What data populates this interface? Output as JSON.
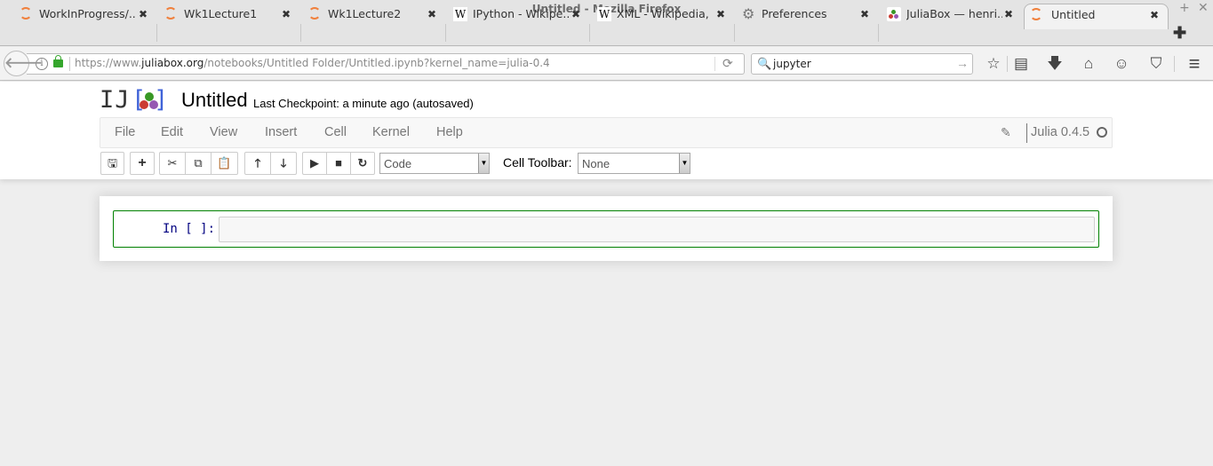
{
  "window": {
    "title": "Untitled - Mozilla Firefox",
    "controls": {
      "minimize": "–",
      "maximize": "+",
      "close": "✕"
    }
  },
  "tabs": [
    {
      "label": "WorkInProgress/...",
      "icon": "spinner-icon",
      "active": false
    },
    {
      "label": "Wk1Lecture1",
      "icon": "spinner-icon",
      "active": false
    },
    {
      "label": "Wk1Lecture2",
      "icon": "spinner-icon",
      "active": false
    },
    {
      "label": "IPython - Wikipe...",
      "icon": "wikipedia-icon",
      "active": false
    },
    {
      "label": "XML - Wikipedia, ...",
      "icon": "wikipedia-icon",
      "active": false
    },
    {
      "label": "Preferences",
      "icon": "gear-icon",
      "active": false
    },
    {
      "label": "JuliaBox — henri....",
      "icon": "juliabox-icon",
      "active": false
    },
    {
      "label": "Untitled",
      "icon": "spinner-icon",
      "active": true
    }
  ],
  "tab_glyphs": {
    "close": "✖",
    "new_tab": "✚",
    "wiki": "W",
    "gear": "⚙"
  },
  "navbar": {
    "url_prefix": "https://www.",
    "url_domain": "juliabox.org",
    "url_path": "/notebooks/Untitled Folder/Untitled.ipynb?kernel_name=julia-0.4",
    "search_value": "jupyter",
    "glyphs": {
      "back": "🡐",
      "info": "i",
      "reload": "⟳",
      "search": "🔍",
      "go": "→",
      "bookmark": "☆",
      "reading_list": "▤",
      "download": "🡇",
      "home": "⌂",
      "chat": "☺",
      "pocket": "⛉",
      "menu": "≡"
    }
  },
  "jupyter": {
    "logo_text": "IJ",
    "logo_brackets": [
      "[",
      "]"
    ],
    "logo_colors": {
      "green": "#389826",
      "red": "#cb3c33",
      "purple": "#9558b2",
      "bracket": "#4063d8"
    },
    "notebook_title": "Untitled",
    "checkpoint": "Last Checkpoint: a minute ago (autosaved)",
    "menu": [
      "File",
      "Edit",
      "View",
      "Insert",
      "Cell",
      "Kernel",
      "Help"
    ],
    "kernel_name": "Julia 0.4.5",
    "edit_glyph": "✎",
    "toolbar": {
      "save": "🖫",
      "insert": "+",
      "cut": "✂",
      "copy": "⧉",
      "paste": "📋",
      "move_up": "🡑",
      "move_down": "🡓",
      "run": "▶",
      "interrupt": "■",
      "restart": "↻",
      "cell_type": "Code",
      "cell_toolbar_label": "Cell Toolbar:",
      "cell_toolbar_value": "None",
      "dropdown_arrow": "▼"
    },
    "cell": {
      "prompt": "In [ ]:",
      "content": ""
    }
  }
}
